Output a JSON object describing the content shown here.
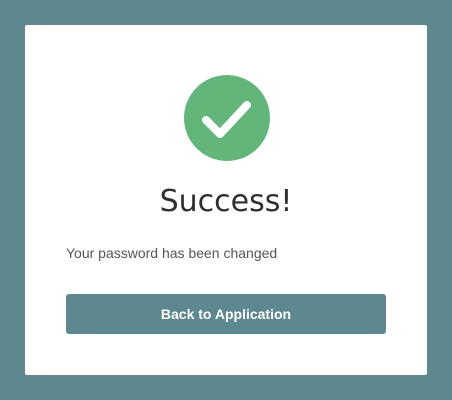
{
  "dialog": {
    "icon": "checkmark-icon",
    "title": "Success!",
    "message": "Your password has been changed",
    "button_label": "Back to Application"
  },
  "colors": {
    "background": "#5e8890",
    "card": "#ffffff",
    "success_green": "#62b67a",
    "button": "#5e8890",
    "button_text": "#ffffff",
    "title_text": "#2f2f2f",
    "message_text": "#555555"
  }
}
